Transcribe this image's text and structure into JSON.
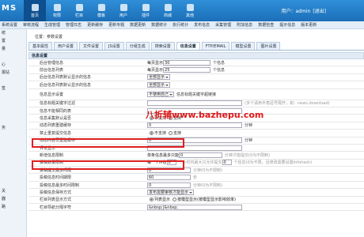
{
  "brand": "MS",
  "main_nav": [
    "首页",
    "权限",
    "栏目",
    "模板",
    "用户",
    "插件",
    "商城",
    "其他"
  ],
  "user_label": "用户：admin",
  "logout": "[退出]",
  "sub_nav": [
    "系统设置",
    "审核流程",
    "生成管理",
    "管理日志",
    "更新缓存",
    "更新专题",
    "数据更新",
    "数据统计",
    "执行统计",
    "发布信息",
    "采集管理",
    "附加信息",
    "数据检查",
    "提示信息",
    "版本更新"
  ],
  "sidebar": [
    "统",
    "置",
    "量",
    "",
    "心",
    "报站",
    "",
    "签",
    "",
    "",
    "",
    "",
    "务",
    "",
    "",
    "",
    "",
    "",
    "",
    "",
    "关",
    "器",
    "路"
  ],
  "breadcrumb": "位置：参数设置",
  "tabs": [
    "基本属性",
    "用户设置",
    "文件设置",
    "JS设置",
    "分组生成",
    "搜索设置",
    "信息设置",
    "FTP/EMAIL",
    "模型设置",
    "图片设置"
  ],
  "active_tab": "信息设置",
  "panel_title": "信息设置",
  "rows": [
    {
      "label": "后台管理信息",
      "pre": "每页显示",
      "value": "30",
      "suf": "个信息"
    },
    {
      "label": "前台信息列表",
      "pre": "每页显示",
      "value": "25",
      "suf": "个信息"
    },
    {
      "label": "后台信息列表默认显示的信息",
      "select": "全部显示"
    },
    {
      "label": "后台信息列表默认显示的信息",
      "select": "全部显示"
    },
    {
      "label": "信息显示设置",
      "select": "不使用自己",
      "suf": "信息标题关键字超链接"
    },
    {
      "label": "信息标题关键字过滤",
      "value": "",
      "suf": "(多个请用半角逗号隔开，如：news,download)"
    },
    {
      "label": "信息不能相同的表",
      "value": ""
    },
    {
      "label": "信息采集默认是否",
      "radio": [
        "不支持",
        "支持"
      ]
    },
    {
      "label": "动态列表重建缓存",
      "value": "0",
      "suf": "分钟"
    },
    {
      "label": "禁止重复提交信息",
      "radio": [
        "不支持",
        "支持"
      ]
    },
    {
      "label": "动态内容页重建缓存",
      "value": "0",
      "suf": "分钟"
    },
    {
      "label": "评论显示",
      "value": "",
      "suf": ""
    },
    {
      "label": "新增信息限制",
      "pre": "单条信息最多只能",
      "value": "0",
      "suf": "分钟才能提交(0为不限制)"
    },
    {
      "label": "投稿数量限制",
      "pre": "每一个IP在",
      "value": "0",
      "suf": "个小时内最大只允许提交",
      "value2": "0",
      "suf2": "个信息(0为不限，且修改需要设置Infohash)"
    },
    {
      "label": "投稿提交最多间隔",
      "value": "0",
      "suf": "分钟(0为不限制)"
    },
    {
      "label": "投稿信息时间期限",
      "value": "60",
      "suf": "秒"
    },
    {
      "label": "投稿信息最多时间限制",
      "value": "0",
      "suf": "分钟(0为不限制)"
    },
    {
      "label": "投稿信息保存方式",
      "select": "发布需要审核才能显示"
    },
    {
      "label": "栏目列表显示方式",
      "radio": [
        "列表显示",
        "按模型显示(按模型显示影响效率)"
      ]
    },
    {
      "label": "栏目导航分隔字符",
      "value": "&nbsp;|&nbsp;"
    }
  ],
  "watermark": "八折辅www.bazhepu.com"
}
